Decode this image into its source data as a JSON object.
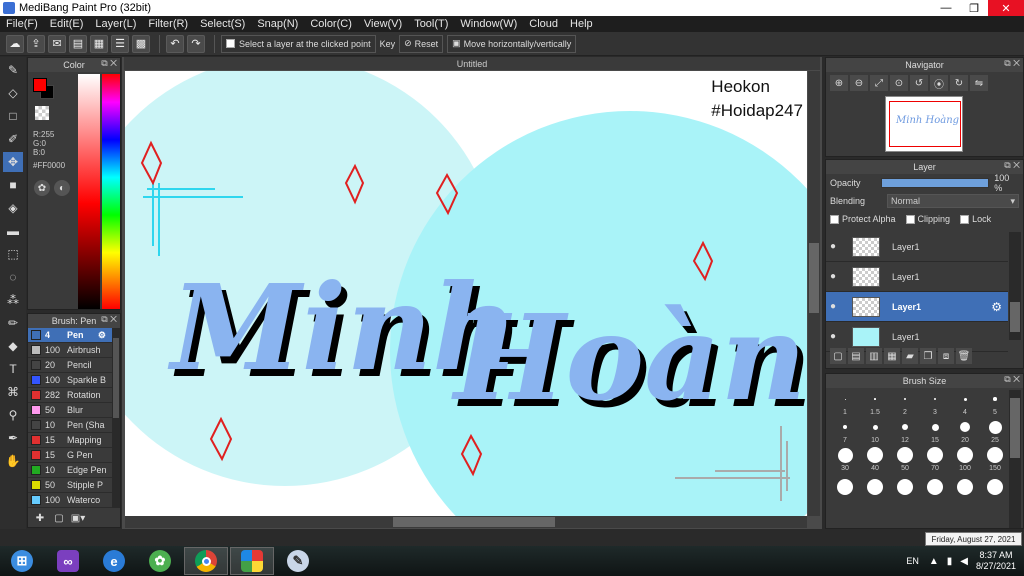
{
  "window": {
    "title": "MediBang Paint Pro (32bit)",
    "min": "—",
    "max": "❐",
    "close": "✕"
  },
  "menu": [
    "File(F)",
    "Edit(E)",
    "Layer(L)",
    "Filter(R)",
    "Select(S)",
    "Snap(N)",
    "Color(C)",
    "View(V)",
    "Tool(T)",
    "Window(W)",
    "Cloud",
    "Help"
  ],
  "toolbar": {
    "select_layer_label": "Select a layer at the clicked point",
    "key_label": "Key",
    "reset_label": "Reset",
    "move_label": "Move horizontally/vertically"
  },
  "color_panel": {
    "title": "Color",
    "r": "R:255",
    "g": "G:0",
    "b": "B:0",
    "hex": "#FF0000",
    "fg_color": "#ff0000",
    "bg_color": "#000000"
  },
  "brush_panel": {
    "title": "Brush: Pen",
    "brushes": [
      {
        "size": "4",
        "name": "Pen",
        "color": "#3f6fb6",
        "active": true
      },
      {
        "size": "100",
        "name": "Airbrush",
        "color": "#bbbbbb"
      },
      {
        "size": "20",
        "name": "Pencil",
        "color": "#444444"
      },
      {
        "size": "100",
        "name": "Sparkle B",
        "color": "#3355ff"
      },
      {
        "size": "282",
        "name": "Rotation",
        "color": "#e03030"
      },
      {
        "size": "50",
        "name": "Blur",
        "color": "#ff99ee"
      },
      {
        "size": "10",
        "name": "Pen (Sha",
        "color": "#444444"
      },
      {
        "size": "15",
        "name": "Mapping",
        "color": "#e03030"
      },
      {
        "size": "15",
        "name": "G Pen",
        "color": "#e03030"
      },
      {
        "size": "10",
        "name": "Edge Pen",
        "color": "#22aa22"
      },
      {
        "size": "50",
        "name": "Stipple P",
        "color": "#dddd00"
      },
      {
        "size": "100",
        "name": "Waterco",
        "color": "#66ccff"
      }
    ]
  },
  "canvas": {
    "tab_title": "Untitled",
    "watermark_line1": "Heokon",
    "watermark_line2": "#Hoidap247",
    "artwork_text": "Minh Hoàng"
  },
  "navigator": {
    "title": "Navigator",
    "thumb_text": "Minh Hoàng"
  },
  "layer_panel": {
    "title": "Layer",
    "opacity_label": "Opacity",
    "opacity_value": "100 %",
    "opacity_fraction": 1.0,
    "blending_label": "Blending",
    "blending_value": "Normal",
    "protect_alpha_label": "Protect Alpha",
    "clipping_label": "Clipping",
    "lock_label": "Lock",
    "layers": [
      {
        "name": "Layer1",
        "active": false,
        "thumb": "checker"
      },
      {
        "name": "Layer1",
        "active": false,
        "thumb": "checker"
      },
      {
        "name": "Layer1",
        "active": true,
        "thumb": "checker"
      },
      {
        "name": "Layer1",
        "active": false,
        "thumb": "blue"
      }
    ]
  },
  "brush_size_panel": {
    "title": "Brush Size",
    "sizes": [
      "1",
      "1.5",
      "2",
      "3",
      "4",
      "5",
      "7",
      "10",
      "12",
      "15",
      "20",
      "25",
      "30",
      "40",
      "50",
      "70",
      "100",
      "150",
      "",
      "",
      "",
      "",
      "",
      ""
    ]
  },
  "taskbar": {
    "date_tooltip": "Friday, August 27, 2021",
    "lang": "EN",
    "time": "8:37 AM",
    "date": "8/27/2021"
  },
  "colors": {
    "accent": "#3f6fb6",
    "canvas_cyan": "#a9f3f8",
    "canvas_light": "#ccf5f7",
    "lettering": "#8ab4f0"
  }
}
